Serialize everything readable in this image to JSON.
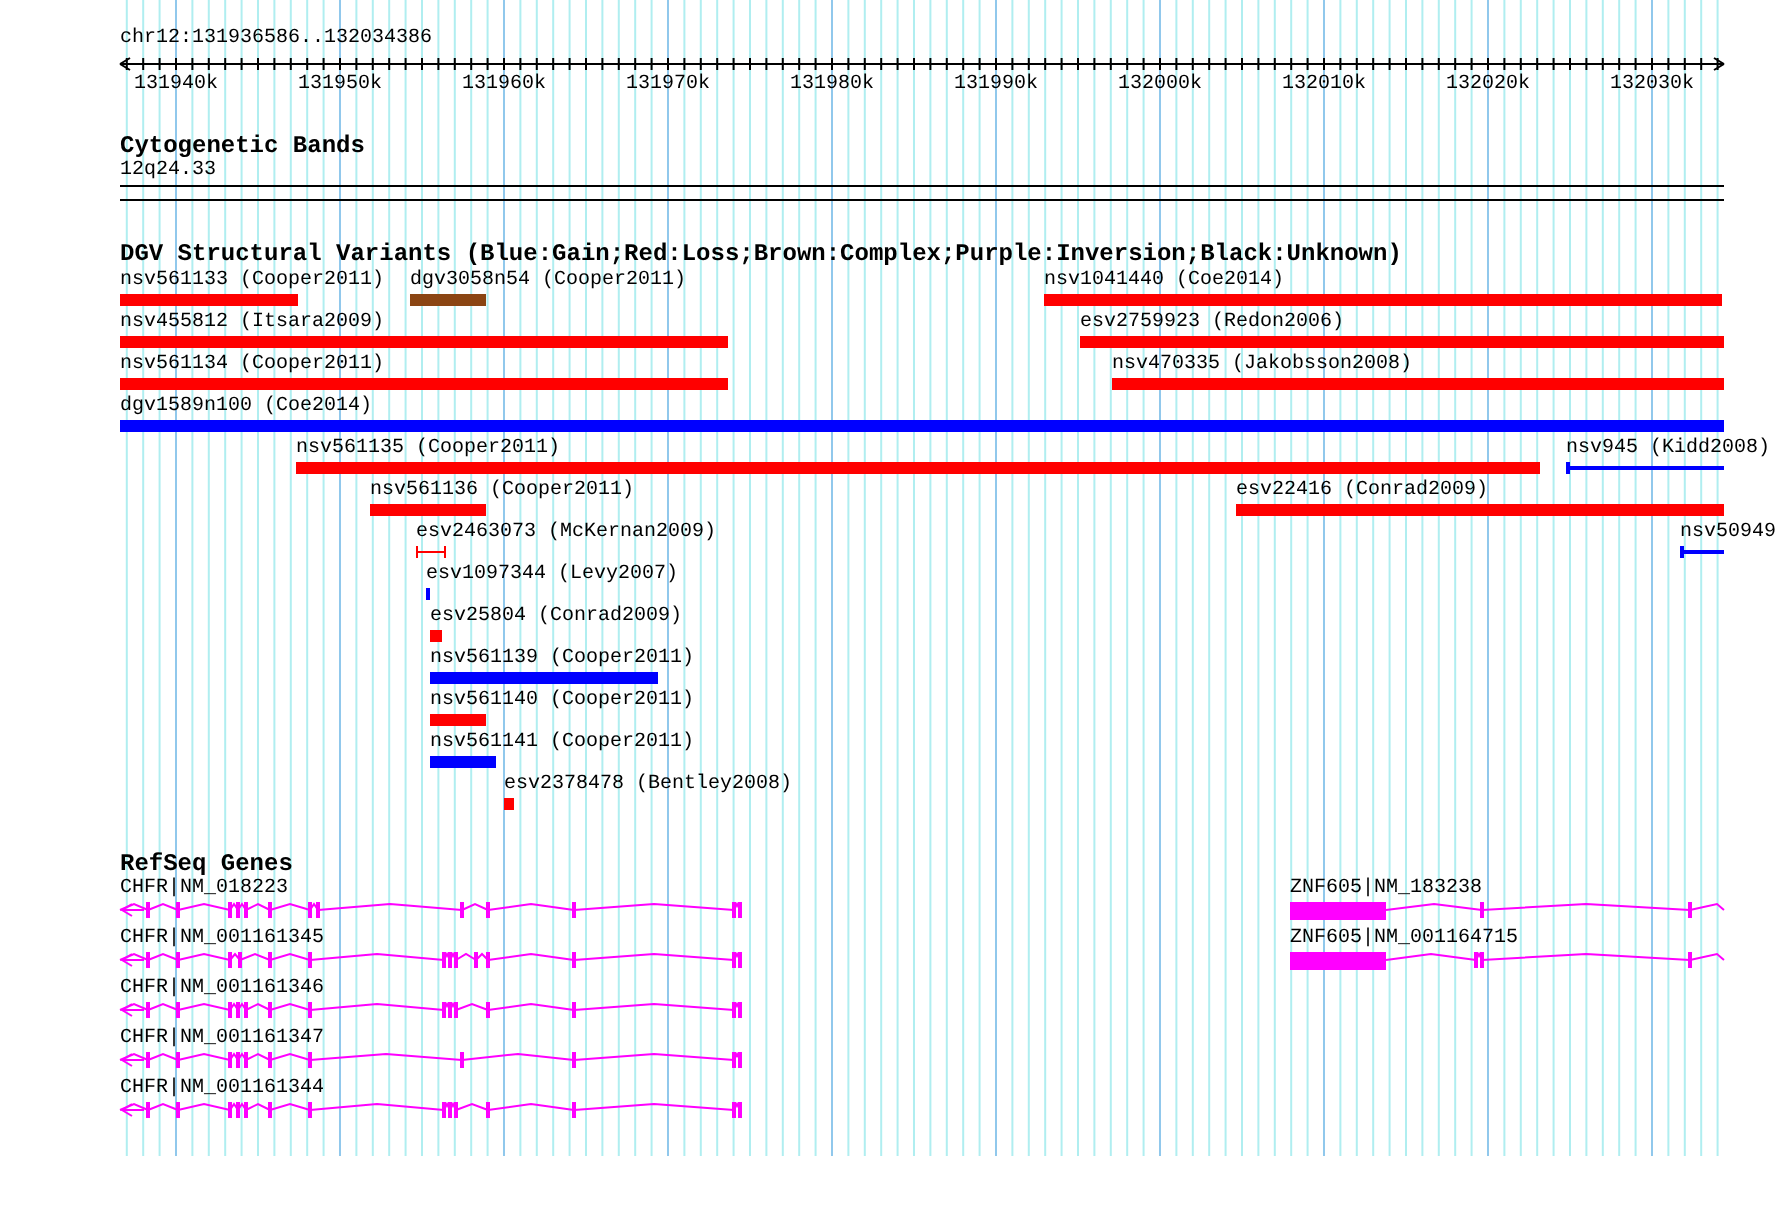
{
  "ruler": {
    "region": "chr12:131936586..132034386",
    "ticks": [
      "131940k",
      "131950k",
      "131960k",
      "131970k",
      "131980k",
      "131990k",
      "132000k",
      "132010k",
      "132020k",
      "132030k"
    ]
  },
  "cytogenetic_bands": {
    "title": "Cytogenetic Bands",
    "band": "12q24.33"
  },
  "dgv_variants": {
    "title": "DGV Structural Variants (Blue:Gain;Red:Loss;Brown:Complex;Purple:Inversion;Black:Unknown)",
    "features": [
      {
        "label": "nsv561133 (Cooper2011)",
        "color": "#ff0000",
        "kind": "bar"
      },
      {
        "label": "dgv3058n54 (Cooper2011)",
        "color": "#8b4513",
        "kind": "bar"
      },
      {
        "label": "nsv1041440 (Coe2014)",
        "color": "#ff0000",
        "kind": "bar"
      },
      {
        "label": "nsv455812 (Itsara2009)",
        "color": "#ff0000",
        "kind": "bar"
      },
      {
        "label": "esv2759923 (Redon2006)",
        "color": "#ff0000",
        "kind": "bar"
      },
      {
        "label": "nsv561134 (Cooper2011)",
        "color": "#ff0000",
        "kind": "bar"
      },
      {
        "label": "nsv470335 (Jakobsson2008)",
        "color": "#ff0000",
        "kind": "bar"
      },
      {
        "label": "dgv1589n100 (Coe2014)",
        "color": "#0000ff",
        "kind": "bar"
      },
      {
        "label": "nsv561135 (Cooper2011)",
        "color": "#ff0000",
        "kind": "bar"
      },
      {
        "label": "nsv945 (Kidd2008)",
        "color": "#0000ff",
        "kind": "line"
      },
      {
        "label": "nsv561136 (Cooper2011)",
        "color": "#ff0000",
        "kind": "bar"
      },
      {
        "label": "esv22416 (Conrad2009)",
        "color": "#ff0000",
        "kind": "bar"
      },
      {
        "label": "esv2463073 (McKernan2009)",
        "color": "#ff0000",
        "kind": "range"
      },
      {
        "label": "nsv50949",
        "color": "#0000ff",
        "kind": "line"
      },
      {
        "label": "esv1097344 (Levy2007)",
        "color": "#0000ff",
        "kind": "bar"
      },
      {
        "label": "esv25804 (Conrad2009)",
        "color": "#ff0000",
        "kind": "bar"
      },
      {
        "label": "nsv561139 (Cooper2011)",
        "color": "#0000ff",
        "kind": "bar"
      },
      {
        "label": "nsv561140 (Cooper2011)",
        "color": "#ff0000",
        "kind": "bar"
      },
      {
        "label": "nsv561141 (Cooper2011)",
        "color": "#0000ff",
        "kind": "bar"
      },
      {
        "label": "esv2378478 (Bentley2008)",
        "color": "#ff0000",
        "kind": "bar"
      }
    ]
  },
  "refseq_genes": {
    "title": "RefSeq Genes",
    "transcripts": [
      {
        "label": "CHFR|NM_018223"
      },
      {
        "label": "CHFR|NM_001161345"
      },
      {
        "label": "CHFR|NM_001161346"
      },
      {
        "label": "CHFR|NM_001161347"
      },
      {
        "label": "CHFR|NM_001161344"
      },
      {
        "label": "ZNF605|NM_183238"
      },
      {
        "label": "ZNF605|NM_001164715"
      }
    ]
  }
}
